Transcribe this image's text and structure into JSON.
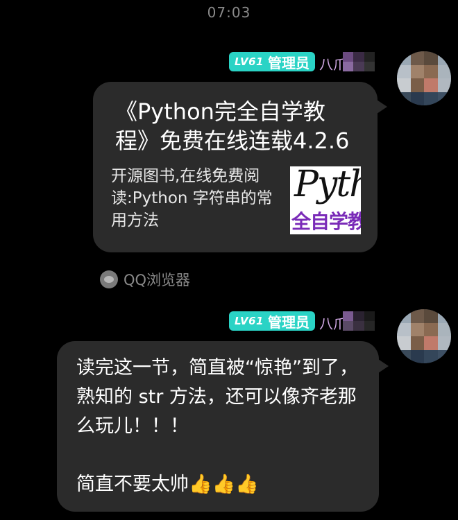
{
  "timestamp": "07:03",
  "messages": [
    {
      "badge_level": "LV61",
      "badge_role": "管理员",
      "sender_name": "八爪",
      "type": "link_card",
      "card_title": "《Python完全自学教程》免费在线连载4.2.6",
      "card_description": "开源图书,在线免费阅读:Python 字符串的常用方法",
      "thumbnail_script": "Pytho",
      "thumbnail_text": "全自学教",
      "source_app": "QQ浏览器"
    },
    {
      "badge_level": "LV61",
      "badge_role": "管理员",
      "sender_name": "八爪",
      "type": "text",
      "text": "读完这一节，简直被“惊艳”到了，熟知的 str 方法，还可以像齐老那么玩儿！！！\n\n简直不要太帅👍👍👍"
    }
  ],
  "colors": {
    "background": "#000000",
    "bubble": "#2b2b2b",
    "badge": "#2ad3c5",
    "nickname": "#d2a9e6",
    "thumbnail_text": "#7a2bb8"
  }
}
